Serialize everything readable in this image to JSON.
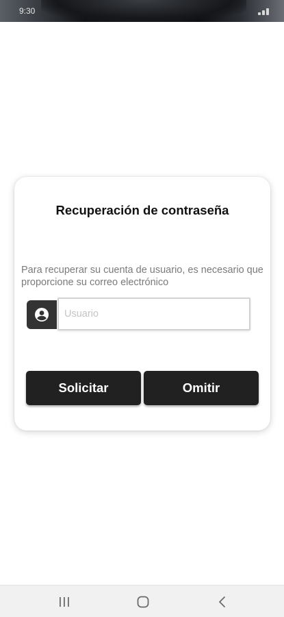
{
  "status_bar": {
    "time": "9:30"
  },
  "card": {
    "title": "Recuperación de contraseña",
    "description": "Para recuperar su cuenta de usuario, es necesario que proporcione su correo electrónico",
    "username_input": {
      "value": "",
      "placeholder": "Usuario",
      "icon": "account-circle-icon"
    },
    "buttons": {
      "request_label": "Solicitar",
      "skip_label": "Omitir"
    }
  },
  "nav_bar": {
    "icons": [
      "recent-apps-icon",
      "home-icon",
      "back-icon"
    ]
  },
  "colors": {
    "button_bg": "#212121",
    "icon_box_bg": "#333333",
    "description_text": "#7a7a7a",
    "nav_bar_bg": "#f1f1f1"
  }
}
